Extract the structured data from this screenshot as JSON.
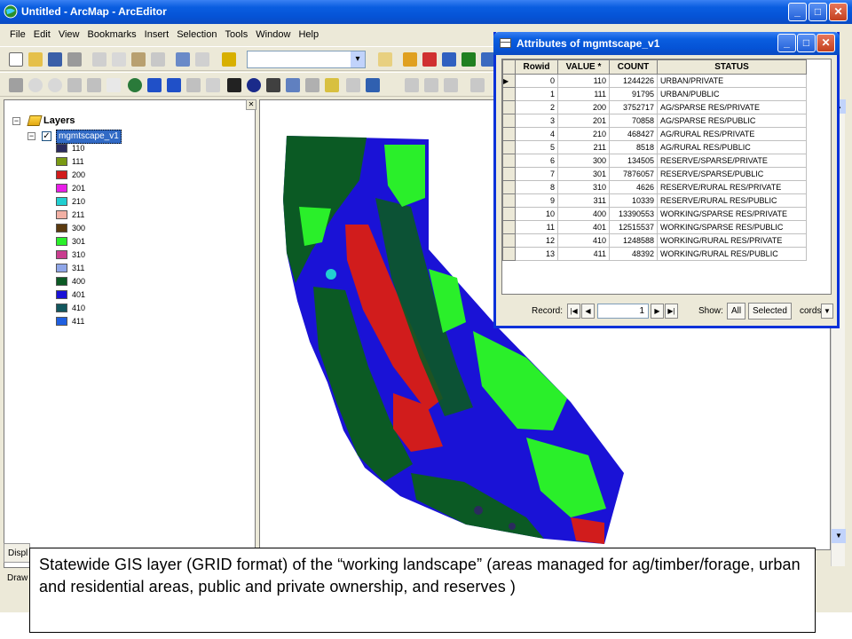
{
  "window": {
    "title": "Untitled - ArcMap - ArcEditor",
    "minimize_label": "_",
    "maximize_label": "□",
    "close_label": "✕"
  },
  "menu": [
    "File",
    "Edit",
    "View",
    "Bookmarks",
    "Insert",
    "Selection",
    "Tools",
    "Window",
    "Help"
  ],
  "toc": {
    "root_label": "Layers",
    "layer_name": "mgmtscape_v1",
    "display_tab": "Displ",
    "draw_label": "Draw",
    "legend": [
      {
        "value": "110",
        "color": "#2b2b5e"
      },
      {
        "value": "111",
        "color": "#7a9a14"
      },
      {
        "value": "200",
        "color": "#d11c1c"
      },
      {
        "value": "201",
        "color": "#e81ee8"
      },
      {
        "value": "210",
        "color": "#21cfd1"
      },
      {
        "value": "211",
        "color": "#f2b0a4"
      },
      {
        "value": "300",
        "color": "#5b3a0f"
      },
      {
        "value": "301",
        "color": "#2aef2a"
      },
      {
        "value": "310",
        "color": "#c93d8f"
      },
      {
        "value": "311",
        "color": "#8fa6e8"
      },
      {
        "value": "400",
        "color": "#0b5a24"
      },
      {
        "value": "401",
        "color": "#1a12d6"
      },
      {
        "value": "410",
        "color": "#12575e"
      },
      {
        "value": "411",
        "color": "#1f5fe0"
      }
    ]
  },
  "attributes": {
    "title": "Attributes of mgmtscape_v1",
    "columns": [
      "Rowid",
      "VALUE *",
      "COUNT",
      "STATUS"
    ],
    "rows": [
      [
        "0",
        "110",
        "1244226",
        "URBAN/PRIVATE"
      ],
      [
        "1",
        "111",
        "91795",
        "URBAN/PUBLIC"
      ],
      [
        "2",
        "200",
        "3752717",
        "AG/SPARSE RES/PRIVATE"
      ],
      [
        "3",
        "201",
        "70858",
        "AG/SPARSE RES/PUBLIC"
      ],
      [
        "4",
        "210",
        "468427",
        "AG/RURAL RES/PRIVATE"
      ],
      [
        "5",
        "211",
        "8518",
        "AG/RURAL RES/PUBLIC"
      ],
      [
        "6",
        "300",
        "134505",
        "RESERVE/SPARSE/PRIVATE"
      ],
      [
        "7",
        "301",
        "7876057",
        "RESERVE/SPARSE/PUBLIC"
      ],
      [
        "8",
        "310",
        "4626",
        "RESERVE/RURAL RES/PRIVATE"
      ],
      [
        "9",
        "311",
        "10339",
        "RESERVE/RURAL RES/PUBLIC"
      ],
      [
        "10",
        "400",
        "13390553",
        "WORKING/SPARSE RES/PRIVATE"
      ],
      [
        "11",
        "401",
        "12515537",
        "WORKING/SPARSE RES/PUBLIC"
      ],
      [
        "12",
        "410",
        "1248588",
        "WORKING/RURAL RES/PRIVATE"
      ],
      [
        "13",
        "411",
        "48392",
        "WORKING/RURAL RES/PUBLIC"
      ]
    ],
    "record_label": "Record:",
    "record_value": "1",
    "show_label": "Show:",
    "all_label": "All",
    "selected_label": "Selected",
    "records_label": "cords"
  },
  "caption": "Statewide GIS layer (GRID format) of the “working landscape” (areas managed for ag/timber/forage, urban and residential areas, public and private ownership, and reserves )",
  "colors": {
    "xp_blue": "#0a5ee0",
    "map_blue": "#1a12d6",
    "map_green": "#2aef2a",
    "map_darkgreen": "#0b5a24",
    "map_red": "#d11c1c"
  }
}
